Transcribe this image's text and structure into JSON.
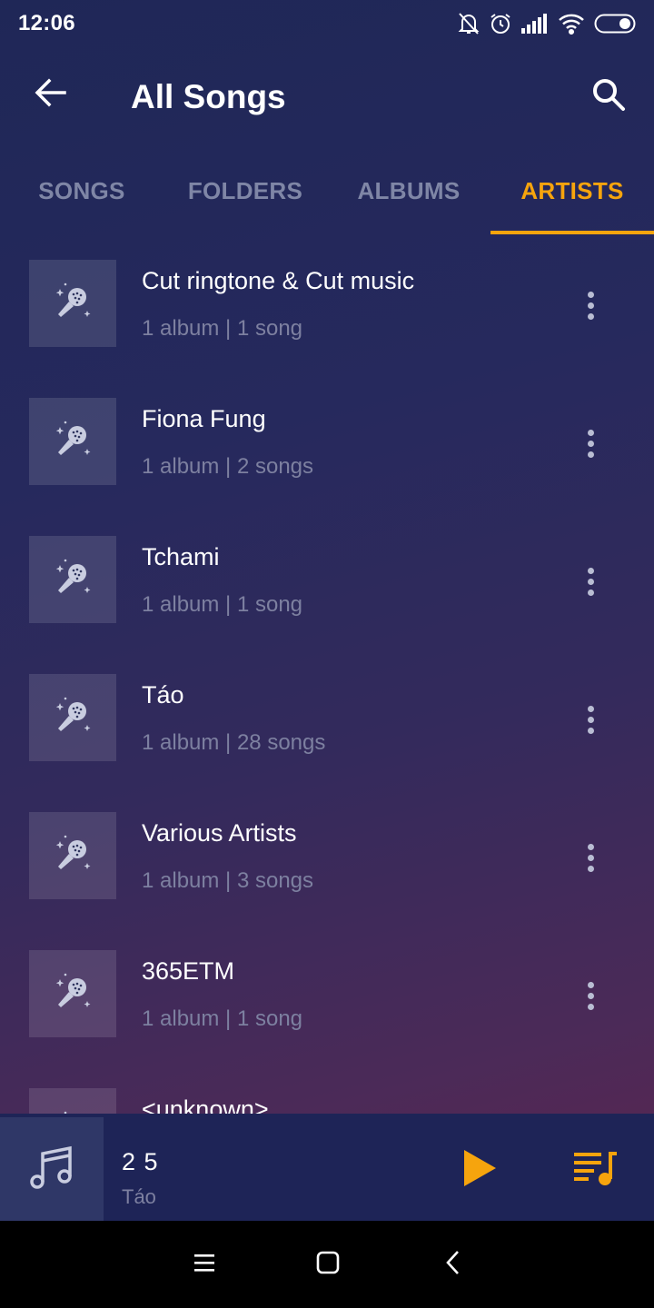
{
  "status_bar": {
    "time": "12:06",
    "icons": [
      "bell-off-icon",
      "alarm-icon",
      "signal-icon",
      "wifi-icon",
      "battery-icon"
    ]
  },
  "header": {
    "title": "All Songs",
    "back_icon": "arrow-left-icon",
    "search_icon": "search-icon"
  },
  "tabs": [
    {
      "label": "SONGS",
      "active": false
    },
    {
      "label": "FOLDERS",
      "active": false
    },
    {
      "label": "ALBUMS",
      "active": false
    },
    {
      "label": "ARTISTS",
      "active": true
    }
  ],
  "artists": [
    {
      "name": "Cut ringtone & Cut music",
      "meta": "1 album | 1 song"
    },
    {
      "name": "Fiona Fung",
      "meta": "1 album | 2 songs"
    },
    {
      "name": "Tchami",
      "meta": "1 album | 1 song"
    },
    {
      "name": "Táo",
      "meta": "1 album | 28 songs"
    },
    {
      "name": "Various Artists",
      "meta": "1 album | 3 songs"
    },
    {
      "name": "365ETM",
      "meta": "1 album | 1 song"
    },
    {
      "name": "<unknown>",
      "meta": ""
    }
  ],
  "player": {
    "track": "2 5",
    "artist": "Táo",
    "art_icon": "music-note-icon",
    "play_icon": "play-icon",
    "queue_icon": "queue-icon"
  },
  "colors": {
    "accent": "#f6a40d",
    "text_primary": "#ffffff",
    "text_secondary": "#7d80a0",
    "tab_inactive": "#7f86a6"
  }
}
